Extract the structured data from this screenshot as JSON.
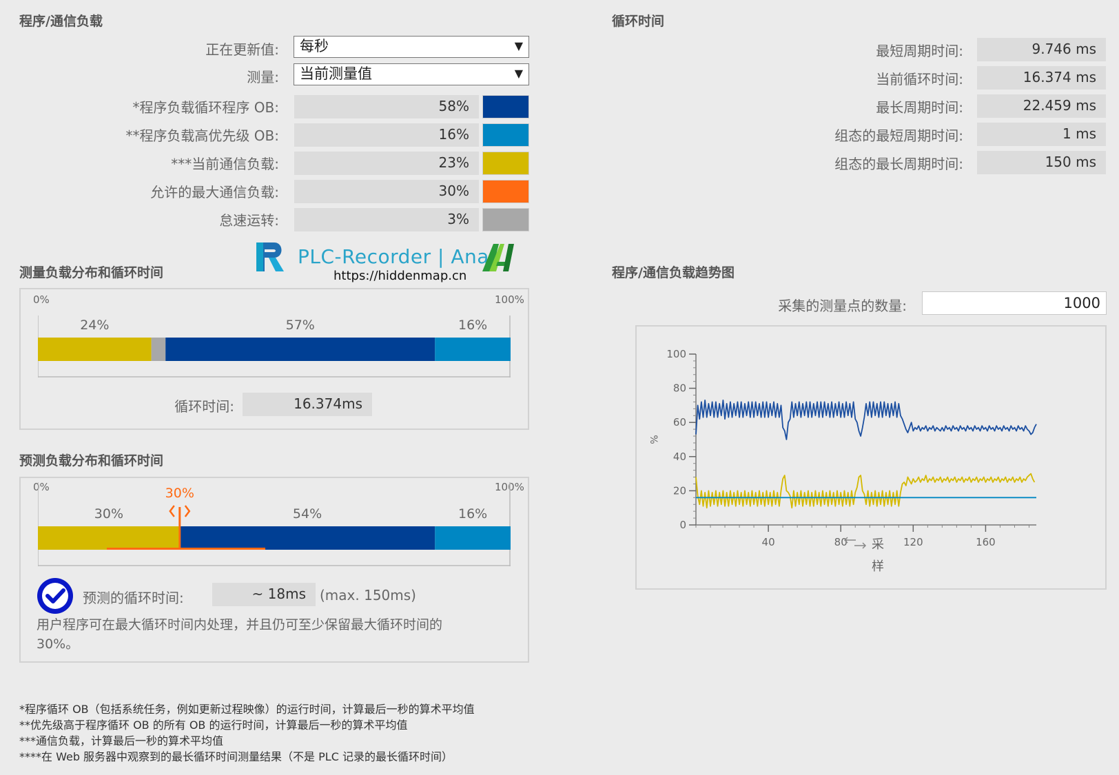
{
  "load_section": {
    "title": "程序/通信负载",
    "update_label": "正在更新值:",
    "update_value": "每秒",
    "measure_label": "测量:",
    "measure_value": "当前测量值",
    "rows": [
      {
        "label": "*程序负载循环程序 OB:",
        "value": "58%",
        "color": "#003f94"
      },
      {
        "label": "**程序负载高优先级 OB:",
        "value": "16%",
        "color": "#0087c3"
      },
      {
        "label": "***当前通信负载:",
        "value": "23%",
        "color": "#d4b900"
      },
      {
        "label": "允许的最大通信负载:",
        "value": "30%",
        "color": "#ff6a13"
      },
      {
        "label": "怠速运转:",
        "value": "3%",
        "color": "#a8a8a8"
      }
    ]
  },
  "cycle_section": {
    "title": "循环时间",
    "rows": [
      {
        "label": "最短周期时间:",
        "value": "9.746 ms"
      },
      {
        "label": "当前循环时间:",
        "value": "16.374 ms"
      },
      {
        "label": "最长周期时间:",
        "value": "22.459 ms"
      },
      {
        "label": "组态的最短周期时间:",
        "value": "1 ms"
      },
      {
        "label": "组态的最长周期时间:",
        "value": "150 ms"
      }
    ]
  },
  "watermark": {
    "title": "PLC-Recorder | Ana",
    "url": "https://hiddenmap.cn"
  },
  "measured": {
    "title": "测量负载分布和循环时间",
    "scale_min": "0%",
    "scale_max": "100%",
    "segments": [
      {
        "label": "24%",
        "fraction": 0.24,
        "color": "#d4b900"
      },
      {
        "label": "",
        "fraction": 0.03,
        "color": "#a8a8a8"
      },
      {
        "label": "57%",
        "fraction": 0.57,
        "color": "#003f94"
      },
      {
        "label": "16%",
        "fraction": 0.16,
        "color": "#0087c3"
      }
    ],
    "cycle_label": "循环时间:",
    "cycle_value": "16.374ms"
  },
  "predicted": {
    "title": "预测负载分布和循环时间",
    "scale_min": "0%",
    "scale_max": "100%",
    "marker_label": "30%",
    "marker_fraction": 0.3,
    "segments": [
      {
        "label": "30%",
        "fraction": 0.3,
        "color": "#d4b900"
      },
      {
        "label": "54%",
        "fraction": 0.54,
        "color": "#003f94"
      },
      {
        "label": "16%",
        "fraction": 0.16,
        "color": "#0087c3"
      }
    ],
    "cycle_label": "预测的循环时间:",
    "cycle_value": "~ 18ms",
    "cycle_max": "(max. 150ms)",
    "message_line1": "用户程序可在最大循环时间内处理，并且仍可至少保留最大循环时间的",
    "message_line2": "30%。"
  },
  "trend": {
    "title": "程序/通信负载趋势图",
    "points_label": "采集的测量点的数量:",
    "points_value": "1000"
  },
  "chart_data": {
    "type": "line",
    "ylabel": "%",
    "xlabel": "采样",
    "ylim": [
      0,
      100
    ],
    "xlim": [
      0,
      188
    ],
    "yticks": [
      0,
      20,
      40,
      60,
      80,
      100
    ],
    "xticks": [
      40,
      80,
      120,
      160
    ],
    "series": [
      {
        "color": "#1c4fa0",
        "values": [
          53,
          70,
          62,
          72,
          63,
          73,
          63,
          71,
          64,
          72,
          63,
          72,
          63,
          71,
          64,
          73,
          62,
          71,
          63,
          72,
          63,
          71,
          64,
          72,
          63,
          72,
          63,
          71,
          64,
          72,
          63,
          72,
          63,
          72,
          64,
          71,
          63,
          72,
          63,
          72,
          63,
          71,
          64,
          72,
          63,
          71,
          63,
          70,
          57,
          55,
          50,
          60,
          62,
          72,
          63,
          71,
          64,
          72,
          63,
          71,
          64,
          72,
          63,
          72,
          63,
          71,
          64,
          72,
          63,
          72,
          63,
          72,
          64,
          71,
          63,
          72,
          63,
          71,
          64,
          72,
          63,
          71,
          63,
          72,
          64,
          71,
          63,
          72,
          62,
          60,
          55,
          52,
          57,
          63,
          71,
          64,
          72,
          63,
          72,
          64,
          71,
          63,
          72,
          63,
          72,
          64,
          71,
          63,
          71,
          64,
          72,
          63,
          71,
          64,
          62,
          59,
          56,
          54,
          57,
          60,
          55,
          57,
          56,
          58,
          55,
          57,
          56,
          58,
          55,
          57,
          56,
          58,
          55,
          57,
          56,
          55,
          57,
          55,
          58,
          56,
          57,
          55,
          58,
          56,
          57,
          55,
          58,
          56,
          57,
          55,
          58,
          56,
          57,
          55,
          58,
          56,
          57,
          55,
          58,
          56,
          57,
          55,
          58,
          56,
          57,
          55,
          58,
          56,
          57,
          55,
          58,
          56,
          57,
          55,
          58,
          56,
          57,
          55,
          58,
          56,
          57,
          55,
          58,
          56,
          55,
          53,
          54,
          57,
          59
        ]
      },
      {
        "color": "#d4b900",
        "values": [
          28,
          17,
          12,
          20,
          11,
          19,
          10,
          20,
          11,
          19,
          12,
          20,
          11,
          19,
          12,
          20,
          11,
          19,
          11,
          20,
          12,
          19,
          11,
          20,
          12,
          19,
          11,
          20,
          12,
          19,
          11,
          20,
          12,
          19,
          11,
          20,
          12,
          19,
          11,
          20,
          12,
          19,
          11,
          20,
          12,
          19,
          11,
          20,
          27,
          29,
          20,
          19,
          17,
          10,
          20,
          11,
          19,
          12,
          20,
          11,
          19,
          12,
          20,
          11,
          19,
          11,
          20,
          12,
          19,
          11,
          20,
          12,
          19,
          11,
          20,
          12,
          19,
          11,
          20,
          12,
          19,
          11,
          20,
          12,
          19,
          11,
          20,
          12,
          19,
          22,
          28,
          29,
          20,
          18,
          12,
          20,
          11,
          19,
          12,
          20,
          11,
          19,
          12,
          20,
          11,
          19,
          12,
          20,
          11,
          19,
          12,
          20,
          11,
          19,
          24,
          25,
          23,
          28,
          26,
          24,
          27,
          25,
          26,
          28,
          25,
          27,
          26,
          29,
          25,
          27,
          26,
          28,
          25,
          27,
          26,
          28,
          25,
          27,
          26,
          28,
          25,
          27,
          26,
          28,
          25,
          27,
          26,
          28,
          25,
          27,
          26,
          28,
          25,
          27,
          26,
          28,
          25,
          27,
          26,
          28,
          25,
          27,
          26,
          28,
          25,
          27,
          26,
          28,
          25,
          27,
          26,
          28,
          25,
          27,
          26,
          28,
          25,
          27,
          26,
          28,
          25,
          27,
          26,
          28,
          29,
          30,
          27,
          25
        ]
      },
      {
        "color": "#0087c3",
        "values": [
          16,
          16,
          16,
          16,
          16,
          16,
          16,
          16,
          16,
          16,
          16,
          16,
          16,
          16,
          16,
          16,
          16,
          16,
          16,
          16,
          16,
          16,
          16,
          16,
          16,
          16,
          16,
          16,
          16,
          16,
          16,
          16,
          16,
          16,
          16,
          16,
          16,
          16,
          16,
          16,
          16,
          16,
          16,
          16,
          16,
          16,
          16,
          16,
          16,
          16,
          16,
          16,
          16,
          16,
          16,
          16,
          16,
          16,
          16,
          16,
          16,
          16,
          16,
          16,
          16,
          16,
          16,
          16,
          16,
          16,
          16,
          16,
          16,
          16,
          16,
          16,
          16,
          16,
          16,
          16,
          16,
          16,
          16,
          16,
          16,
          16,
          16,
          16,
          16,
          16,
          16,
          16,
          16,
          16,
          16,
          16,
          16,
          16,
          16,
          16,
          16,
          16,
          16,
          16,
          16,
          16,
          16,
          16,
          16,
          16,
          16,
          16,
          16,
          16,
          16,
          16,
          16,
          16,
          16,
          16,
          16,
          16,
          16,
          16,
          16,
          16,
          16,
          16,
          16,
          16,
          16,
          16,
          16,
          16,
          16,
          16,
          16,
          16,
          16,
          16,
          16,
          16,
          16,
          16,
          16,
          16,
          16,
          16,
          16,
          16,
          16,
          16,
          16,
          16,
          16,
          16,
          16,
          16,
          16,
          16,
          16,
          16,
          16,
          16,
          16,
          16,
          16,
          16,
          16,
          16,
          16,
          16,
          16,
          16,
          16,
          16,
          16,
          16,
          16,
          16,
          16,
          16,
          16,
          16,
          16,
          16,
          16,
          16,
          16
        ]
      }
    ]
  },
  "footnotes": [
    "*程序循环 OB（包括系统任务，例如更新过程映像）的运行时间，计算最后一秒的算术平均值",
    "**优先级高于程序循环 OB 的所有 OB 的运行时间，计算最后一秒的算术平均值",
    "***通信负载，计算最后一秒的算术平均值",
    "****在 Web 服务器中观察到的最长循环时间测量结果（不是 PLC 记录的最长循环时间）"
  ]
}
